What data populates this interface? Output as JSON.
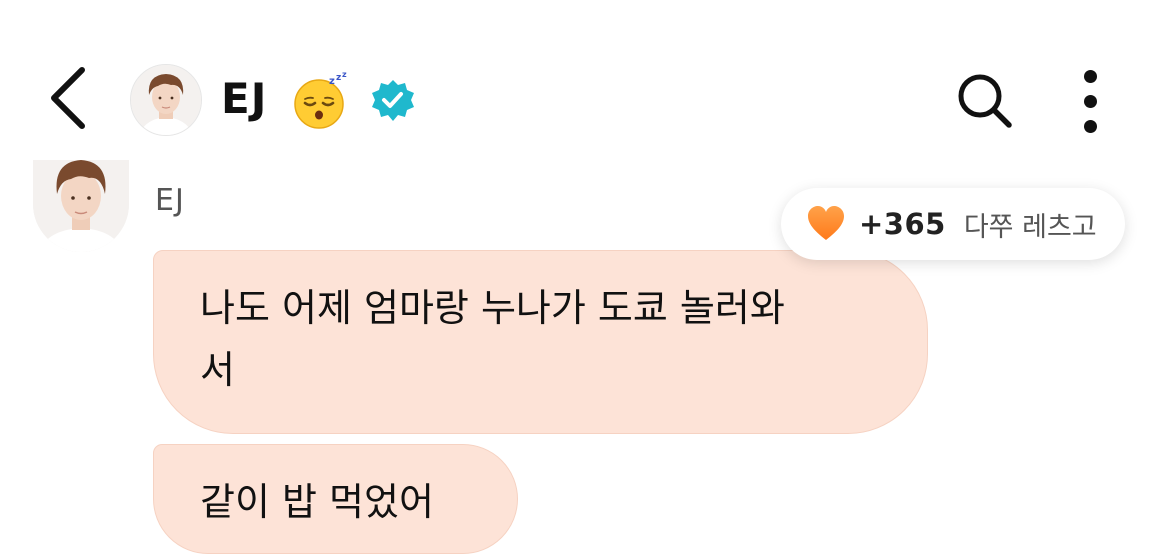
{
  "header": {
    "back_icon": "chevron-left-icon",
    "title": "EJ",
    "status_emoji": "sleeping-face-emoji",
    "verified_icon": "verified-badge-icon",
    "search_icon": "search-icon",
    "more_icon": "more-vertical-icon"
  },
  "message": {
    "sender_name": "EJ",
    "bubbles": [
      {
        "text_line1": "나도 어제 엄마랑 누나가 도쿄 놀러와",
        "text_line2": "서"
      },
      {
        "text": "같이 밥 먹었어"
      }
    ]
  },
  "reaction": {
    "icon": "orange-heart-icon",
    "count": "+365",
    "label": "다쭈 레츠고"
  },
  "colors": {
    "bubble_bg": "#fde3d7",
    "verified_badge": "#1fb8cd",
    "heart": "#ff8a2b"
  }
}
